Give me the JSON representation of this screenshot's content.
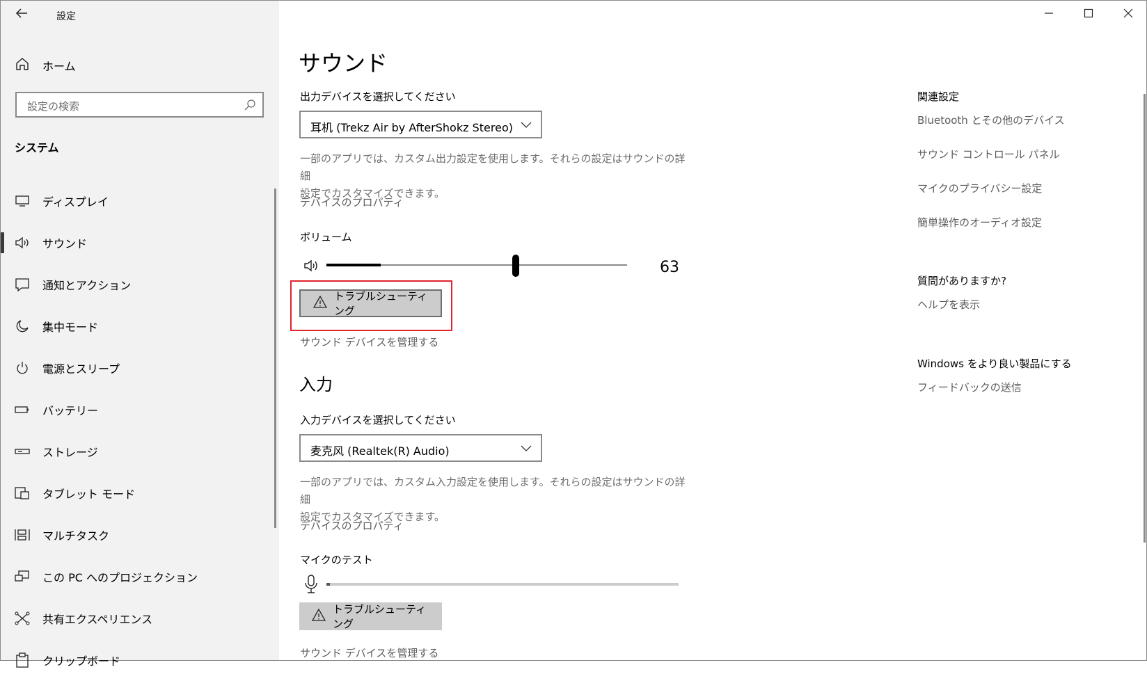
{
  "window": {
    "title": "設定",
    "controls": [
      "minimize",
      "maximize",
      "close"
    ]
  },
  "sidebar": {
    "home_label": "ホーム",
    "search_placeholder": "設定の検索",
    "section": "システム",
    "items": [
      {
        "label": "ディスプレイ",
        "icon": "monitor-icon"
      },
      {
        "label": "サウンド",
        "icon": "speaker-icon",
        "active": true
      },
      {
        "label": "通知とアクション",
        "icon": "notification-icon"
      },
      {
        "label": "集中モード",
        "icon": "moon-icon"
      },
      {
        "label": "電源とスリープ",
        "icon": "power-icon"
      },
      {
        "label": "バッテリー",
        "icon": "battery-icon"
      },
      {
        "label": "ストレージ",
        "icon": "storage-icon"
      },
      {
        "label": "タブレット モード",
        "icon": "tablet-icon"
      },
      {
        "label": "マルチタスク",
        "icon": "multitask-icon"
      },
      {
        "label": "この PC へのプロジェクション",
        "icon": "projection-icon"
      },
      {
        "label": "共有エクスペリエンス",
        "icon": "share-icon"
      },
      {
        "label": "クリップボード",
        "icon": "clipboard-icon"
      }
    ]
  },
  "main": {
    "title": "サウンド",
    "output": {
      "select_label": "出力デバイスを選択してください",
      "device": "耳机 (Trekz Air by AfterShokz Stereo)",
      "description": "一部のアプリでは、カスタム出力設定を使用します。それらの設定はサウンドの詳細設定でカスタマイズできます。",
      "description_line1": "一部のアプリでは、カスタム出力設定を使用します。それらの設定はサウンドの詳細",
      "description_line2": "設定でカスタマイズできます。",
      "properties_link": "デバイスのプロパティ",
      "volume_label": "ボリューム",
      "volume_value": "63",
      "volume_level": 63,
      "peak_level": 18,
      "troubleshoot": "トラブルシューティング",
      "manage_link": "サウンド デバイスを管理する"
    },
    "input": {
      "heading": "入力",
      "select_label": "入力デバイスを選択してください",
      "device": "麦克风 (Realtek(R) Audio)",
      "description_line1": "一部のアプリでは、カスタム入力設定を使用します。それらの設定はサウンドの詳細",
      "description_line2": "設定でカスタマイズできます。",
      "properties_link": "デバイスのプロパティ",
      "mic_test_label": "マイクのテスト",
      "mic_level": 1,
      "troubleshoot": "トラブルシューティング",
      "manage_link": "サウンド デバイスを管理する"
    }
  },
  "related": {
    "heading": "関連設定",
    "links": [
      "Bluetooth とその他のデバイス",
      "サウンド コントロール パネル",
      "マイクのプライバシー設定",
      "簡単操作のオーディオ設定"
    ],
    "question_heading": "質問がありますか?",
    "help_link": "ヘルプを表示",
    "feedback_heading": "Windows をより良い製品にする",
    "feedback_link": "フィードバックの送信"
  },
  "colors": {
    "highlight": "#e0242b",
    "sidebar_bg": "#f2f2f2",
    "button_bg": "#cccccc"
  }
}
